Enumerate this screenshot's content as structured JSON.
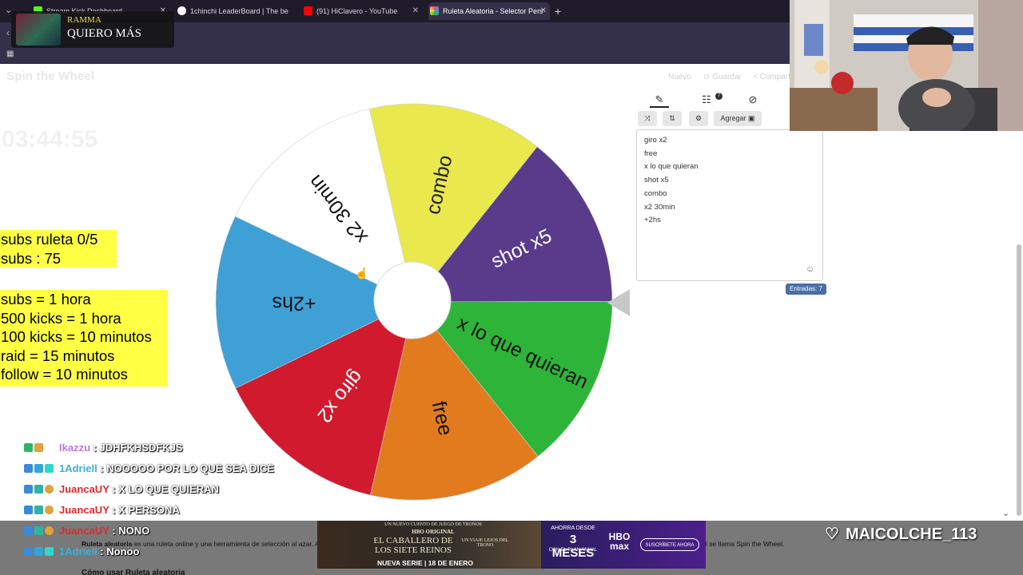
{
  "browser": {
    "tabs": [
      {
        "label": "Stream Kick Dashboard",
        "color": "#53fc18"
      },
      {
        "label": "1chinchi LeaderBoard | The be",
        "color": "#ffffff"
      },
      {
        "label": "(91) HiClavero - YouTube",
        "color": "#ff0000"
      },
      {
        "label": "Ruleta Aleatoria - Selector Pers",
        "color": "#e84a7f"
      }
    ],
    "new_tab": "+"
  },
  "page": {
    "logo": "Spin the Wheel",
    "timer": "03:44:55",
    "actions": [
      "Nuevo",
      "Guardar",
      "Compartir"
    ]
  },
  "wheel": {
    "segments": [
      {
        "label": "combo",
        "color": "#e9e84d",
        "text_color": "#222222"
      },
      {
        "label": "shot x5",
        "color": "#5a3a8a",
        "text_color": "#ffffff"
      },
      {
        "label": "x lo que quieran",
        "color": "#2eb539",
        "text_color": "#111111"
      },
      {
        "label": "free",
        "color": "#e17b1e",
        "text_color": "#111111"
      },
      {
        "label": "giro x2",
        "color": "#d21a2f",
        "text_color": "#ffffff"
      },
      {
        "label": "+2hs",
        "color": "#3fa0d6",
        "text_color": "#111111"
      },
      {
        "label": "x2 30min",
        "color": "#ffffff",
        "text_color": "#111111"
      }
    ]
  },
  "panel": {
    "add_button": "Agregar",
    "entries": [
      "giro x2",
      "free",
      "x lo que quieran",
      "shot x5",
      "combo",
      "x2 30min",
      "+2hs"
    ],
    "count_label": "Entradas: 7",
    "badge": "7"
  },
  "overlay": {
    "alert": {
      "user": "RAMMA",
      "message": "QUIERO MÁS"
    },
    "subs": [
      "subs ruleta 0/5",
      "subs : 75"
    ],
    "rules": [
      "subs = 1 hora",
      "500 kicks = 1 hora",
      "100 kicks = 10 minutos",
      "raid = 15 minutos",
      "follow = 10 minutos"
    ],
    "chat": [
      {
        "user": "Ikazzu",
        "user_color": "#b47ae0",
        "message": " : JDHFKHSDFKJS"
      },
      {
        "user": "1Adriell",
        "user_color": "#3ab0e0",
        "message": " : NOOOOO POR LO QUE SEA DICE"
      },
      {
        "user": "JuancaUY",
        "user_color": "#e0282c",
        "message": " : X LO QUE QUIERAN"
      },
      {
        "user": "JuancaUY",
        "user_color": "#e0282c",
        "message": " : X PERSONA"
      },
      {
        "user": "JuancaUY",
        "user_color": "#e0282c",
        "message": " : NONO"
      },
      {
        "user": "1Adriell",
        "user_color": "#3ab0e0",
        "message": " : Nonoo"
      }
    ],
    "last_follower": "MAICOLCHE_113"
  },
  "description": {
    "title": "Ruleta aleatoria",
    "text": "es una ruleta online y una herramienta de selección al azar. Agrega tus propias entradas, aplica temas y cambia los sonidos, y deja que la ruleta decida por ti. Nuestra aplicación internacional se llama Spin the Wheel.",
    "subheading": "Cómo usar Ruleta aleatoria"
  },
  "ad": {
    "top": "UN NUEVO CUENTO DE JUEGO DE TRONOS",
    "brand": "HBO ORIGINAL",
    "title": "EL CABALLERO DE LOS SIETE REINOS",
    "subtitle": "UN VIAJE LEJOS DEL TRONO",
    "footer": "NUEVA SERIE | 18 DE ENERO",
    "offer_line1": "AHORRA DESDE",
    "offer_line2": "3 MESES",
    "offer_line3": "CON EL PLAN ANUAL",
    "hbo": "HBO max",
    "cta": "SUSCRÍBETE AHORA"
  }
}
